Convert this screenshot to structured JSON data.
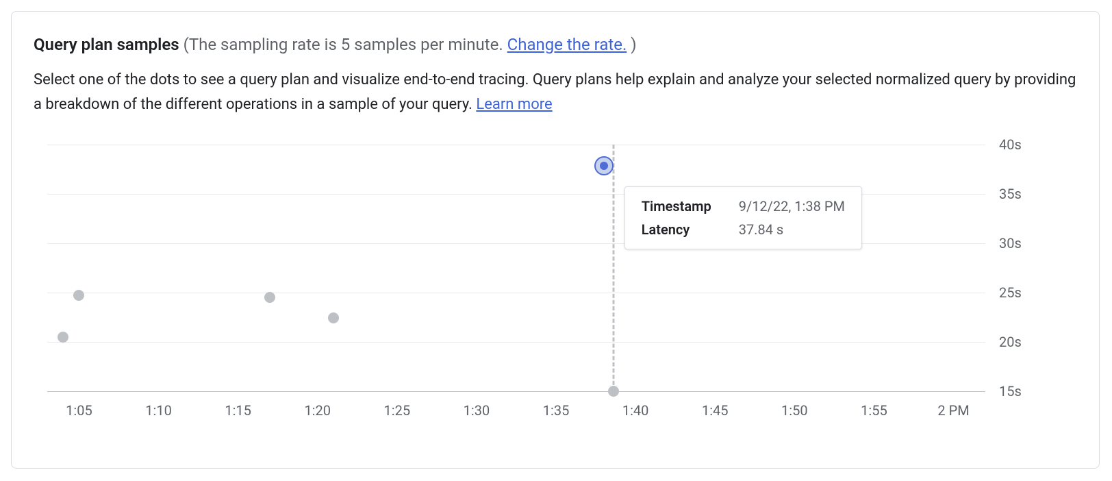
{
  "header": {
    "title": "Query plan samples",
    "subtitle_prefix": "(The sampling rate is 5 samples per minute. ",
    "change_rate_link": "Change the rate.",
    "subtitle_suffix": " )"
  },
  "description": {
    "text": "Select one of the dots to see a query plan and visualize end-to-end tracing. Query plans help explain and analyze your selected normalized query by providing a breakdown of the different operations in a sample of your query. ",
    "learn_more": "Learn more"
  },
  "tooltip": {
    "timestamp_label": "Timestamp",
    "timestamp_value": "9/12/22, 1:38 PM",
    "latency_label": "Latency",
    "latency_value": "37.84 s"
  },
  "chart_data": {
    "type": "scatter",
    "title": "",
    "xlabel": "",
    "ylabel": "",
    "ylim": [
      15,
      40
    ],
    "y_ticks": [
      "15s",
      "20s",
      "25s",
      "30s",
      "35s",
      "40s"
    ],
    "x_ticks": [
      "1:05",
      "1:10",
      "1:15",
      "1:20",
      "1:25",
      "1:30",
      "1:35",
      "1:40",
      "1:45",
      "1:50",
      "1:55",
      "2 PM"
    ],
    "x_range": [
      "1:03",
      "2:02"
    ],
    "points": [
      {
        "time": "1:04",
        "time_min": 64,
        "latency_s": 20.5,
        "selected": false
      },
      {
        "time": "1:05",
        "time_min": 65,
        "latency_s": 24.7,
        "selected": false
      },
      {
        "time": "1:17",
        "time_min": 77,
        "latency_s": 24.5,
        "selected": false
      },
      {
        "time": "1:21",
        "time_min": 81,
        "latency_s": 22.4,
        "selected": false
      },
      {
        "time": "1:38",
        "time_min": 98,
        "latency_s": 37.84,
        "selected": true
      }
    ],
    "crosshair_time_min": 98.6
  }
}
